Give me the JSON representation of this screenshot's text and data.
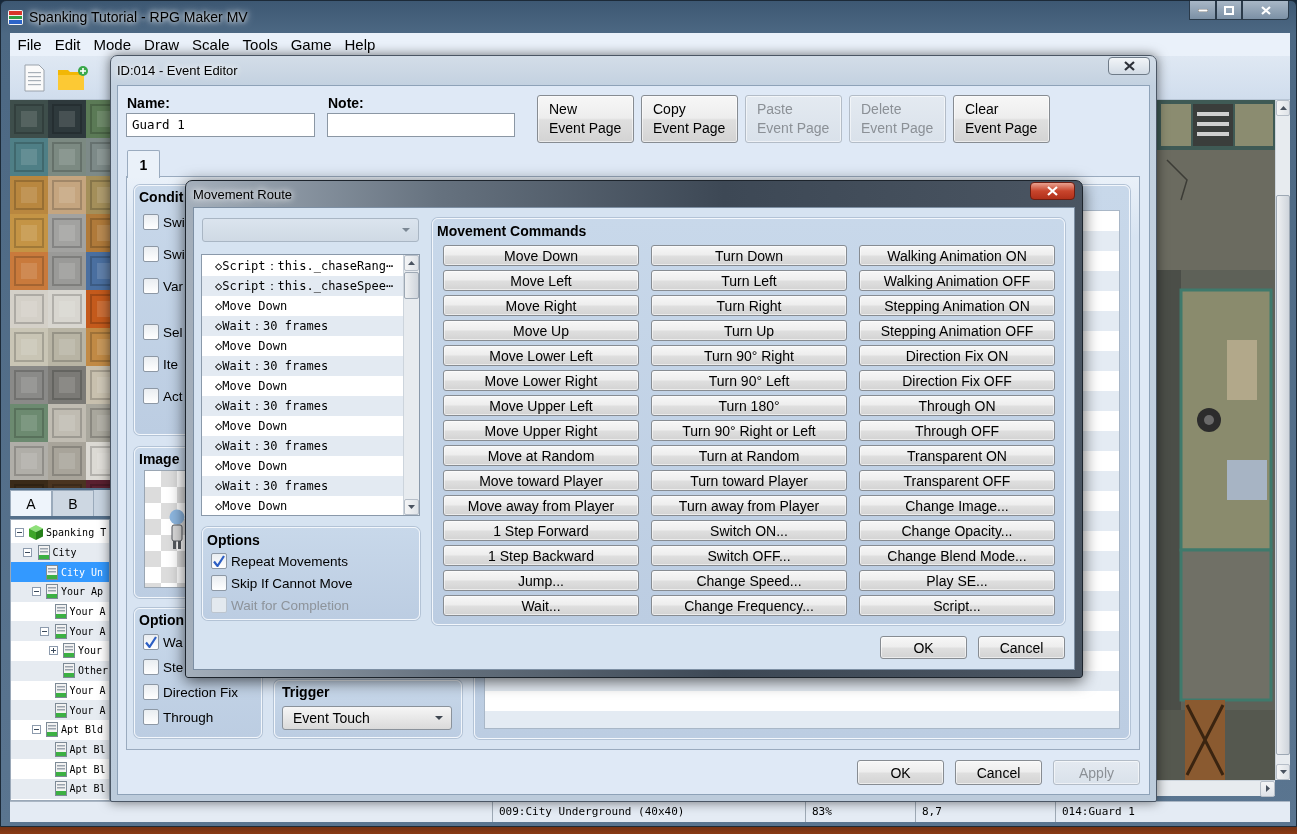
{
  "window": {
    "title": "Spanking Tutorial - RPG Maker MV"
  },
  "menu": [
    "File",
    "Edit",
    "Mode",
    "Draw",
    "Scale",
    "Tools",
    "Game",
    "Help"
  ],
  "tileset_tabs": [
    {
      "label": "A",
      "selected": true
    },
    {
      "label": "B",
      "selected": false
    }
  ],
  "map_tree": [
    {
      "label": "Spanking T",
      "kind": "project",
      "expanded": true,
      "selected": false,
      "children": [
        {
          "label": "City",
          "kind": "map",
          "expanded": true,
          "selected": false,
          "children": [
            {
              "label": "City Un",
              "kind": "map",
              "selected": true
            },
            {
              "label": "Your Ap",
              "kind": "map",
              "expanded": true,
              "selected": false,
              "children": [
                {
                  "label": "Your A",
                  "kind": "map",
                  "selected": false
                },
                {
                  "label": "Your A",
                  "kind": "map",
                  "expanded": true,
                  "selected": false,
                  "children": [
                    {
                      "label": "Your",
                      "kind": "map",
                      "expanded": false,
                      "selected": false
                    },
                    {
                      "label": "Other",
                      "kind": "map",
                      "selected": false
                    }
                  ]
                },
                {
                  "label": "Your A",
                  "kind": "map",
                  "selected": false
                },
                {
                  "label": "Your A",
                  "kind": "map",
                  "selected": false
                }
              ]
            },
            {
              "label": "Apt Bld",
              "kind": "map",
              "expanded": true,
              "selected": false,
              "children": [
                {
                  "label": "Apt Bl",
                  "kind": "map",
                  "selected": false
                },
                {
                  "label": "Apt Bl",
                  "kind": "map",
                  "selected": false
                },
                {
                  "label": "Apt Bl",
                  "kind": "map",
                  "selected": false
                }
              ]
            }
          ]
        }
      ]
    }
  ],
  "status_bar": [
    "009:City Underground (40x40)",
    "83%",
    "8,7",
    "014:Guard 1"
  ],
  "event_editor": {
    "title": "ID:014 - Event Editor",
    "name": {
      "label": "Name:",
      "value": "Guard 1"
    },
    "note": {
      "label": "Note:"
    },
    "page_buttons": [
      {
        "lines": [
          "New",
          "Event Page"
        ],
        "disabled": false
      },
      {
        "lines": [
          "Copy",
          "Event Page"
        ],
        "disabled": false
      },
      {
        "lines": [
          "Paste",
          "Event Page"
        ],
        "disabled": true
      },
      {
        "lines": [
          "Delete",
          "Event Page"
        ],
        "disabled": true
      },
      {
        "lines": [
          "Clear",
          "Event Page"
        ],
        "disabled": false
      }
    ],
    "tabs": [
      {
        "label": "1",
        "selected": true
      }
    ],
    "conditions": {
      "title": "Condit",
      "groups": [
        [
          {
            "label": "Swi",
            "checked": false
          },
          {
            "label": "Swi",
            "checked": false
          },
          {
            "label": "Var",
            "checked": false
          }
        ],
        [
          {
            "label": "Sel",
            "checked": false
          },
          {
            "label": "Ite",
            "checked": false
          },
          {
            "label": "Act",
            "checked": false
          }
        ]
      ]
    },
    "image": {
      "title": "Image"
    },
    "options": {
      "title": "Option",
      "items": [
        {
          "label": "Wa",
          "checked": true
        },
        {
          "label": "Ste",
          "checked": false
        },
        {
          "label": "Direction Fix",
          "checked": false
        },
        {
          "label": "Through",
          "checked": false
        }
      ]
    },
    "trigger": {
      "title": "Trigger",
      "value": "Event Touch"
    },
    "buttons": [
      {
        "label": "OK",
        "disabled": false
      },
      {
        "label": "Cancel",
        "disabled": false
      },
      {
        "label": "Apply",
        "disabled": true
      }
    ]
  },
  "movement_route": {
    "title": "Movement Route",
    "route": [
      "◇Script：this._chaseRang⋯",
      "◇Script：this._chaseSpee⋯",
      "◇Move Down",
      "◇Wait：30 frames",
      "◇Move Down",
      "◇Wait：30 frames",
      "◇Move Down",
      "◇Wait：30 frames",
      "◇Move Down",
      "◇Wait：30 frames",
      "◇Move Down",
      "◇Wait：30 frames",
      "◇Move Down"
    ],
    "options": {
      "title": "Options",
      "items": [
        {
          "label": "Repeat Movements",
          "checked": true,
          "disabled": false
        },
        {
          "label": "Skip If Cannot Move",
          "checked": false,
          "disabled": false
        },
        {
          "label": "Wait for Completion",
          "checked": false,
          "disabled": true
        }
      ]
    },
    "commands": {
      "title": "Movement Commands",
      "columns": [
        [
          "Move Down",
          "Move Left",
          "Move Right",
          "Move Up",
          "Move Lower Left",
          "Move Lower Right",
          "Move Upper Left",
          "Move Upper Right",
          "Move at Random",
          "Move toward Player",
          "Move away from Player",
          "1 Step Forward",
          "1 Step Backward",
          "Jump...",
          "Wait..."
        ],
        [
          "Turn Down",
          "Turn Left",
          "Turn Right",
          "Turn Up",
          "Turn 90° Right",
          "Turn 90° Left",
          "Turn 180°",
          "Turn 90° Right or Left",
          "Turn at Random",
          "Turn toward Player",
          "Turn away from Player",
          "Switch ON...",
          "Switch OFF...",
          "Change Speed...",
          "Change Frequency..."
        ],
        [
          "Walking Animation ON",
          "Walking Animation OFF",
          "Stepping Animation ON",
          "Stepping Animation OFF",
          "Direction Fix ON",
          "Direction Fix OFF",
          "Through ON",
          "Through OFF",
          "Transparent ON",
          "Transparent OFF",
          "Change Image...",
          "Change Opacity...",
          "Change Blend Mode...",
          "Play SE...",
          "Script..."
        ]
      ]
    },
    "buttons": [
      {
        "label": "OK",
        "disabled": false
      },
      {
        "label": "Cancel",
        "disabled": false
      }
    ]
  }
}
